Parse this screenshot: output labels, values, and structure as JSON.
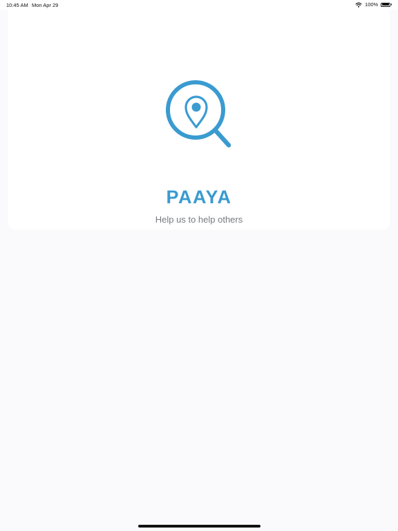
{
  "status_bar": {
    "time": "10:45 AM",
    "date": "Mon Apr 29",
    "battery": "100%",
    "wifi_icon": "wifi-icon",
    "battery_icon": "battery-icon"
  },
  "splash": {
    "logo_icon": "location-search-icon",
    "title": "PAAYA",
    "subtitle": "Help us to help others",
    "accent_color": "#3a9bd0"
  }
}
